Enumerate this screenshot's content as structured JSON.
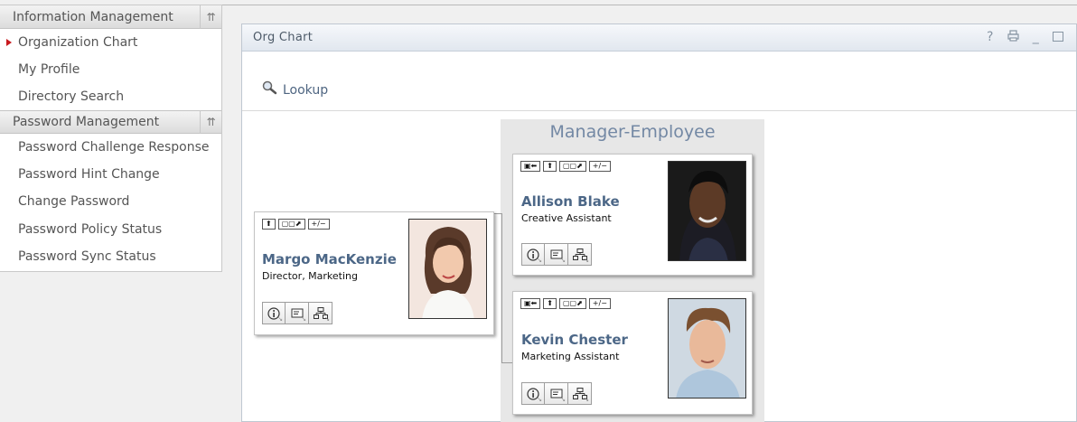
{
  "nav": {
    "info_section": "Information Management",
    "info_items": [
      "Organization Chart",
      "My Profile",
      "Directory Search"
    ],
    "pwd_section": "Password Management",
    "pwd_items": [
      "Password Challenge Response",
      "Password Hint Change",
      "Change Password",
      "Password Policy Status",
      "Password Sync Status"
    ],
    "collapse_glyph": "≈",
    "active_marker_color": "#c8191e"
  },
  "portlet": {
    "title": "Org Chart",
    "controls": {
      "help": "?",
      "print": "🖶",
      "minimize": "_"
    },
    "lookup_label": "Lookup"
  },
  "chart": {
    "group_title": "Manager-Employee",
    "buttons": {
      "move_up": "⬆",
      "expand": "▢▢⬈",
      "toggle": "+/−",
      "back": "▣⬅"
    },
    "manager": {
      "name": "Margo MacKenzie",
      "title": "Director, Marketing"
    },
    "employees": [
      {
        "name": "Allison Blake",
        "title": "Creative Assistant"
      },
      {
        "name": "Kevin Chester",
        "title": "Marketing Assistant"
      }
    ]
  },
  "colors": {
    "accent_text": "#4c6787",
    "link": "#4e6581",
    "group_title": "#7388a4"
  }
}
